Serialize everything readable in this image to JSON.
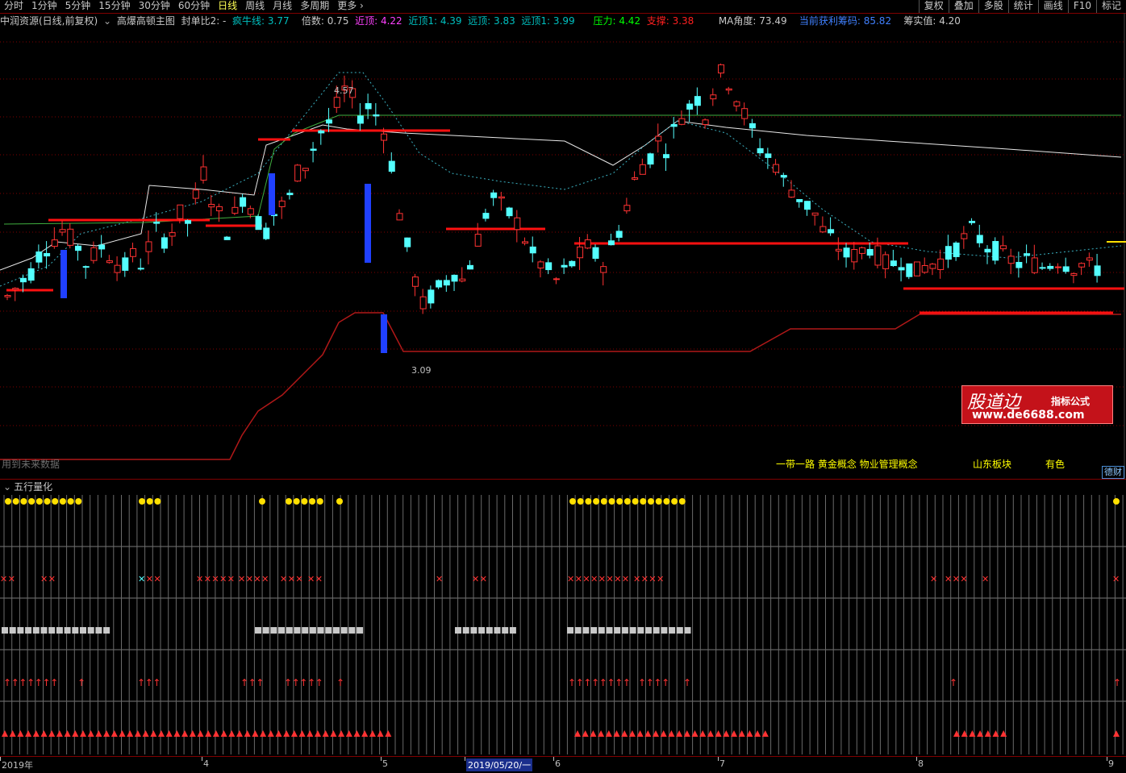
{
  "toolbar": {
    "tabs": [
      "分时",
      "1分钟",
      "5分钟",
      "15分钟",
      "30分钟",
      "60分钟",
      "日线",
      "周线",
      "月线",
      "多周期",
      "更多"
    ],
    "active_tab": "日线",
    "right_tools": [
      "复权",
      "叠加",
      "多股",
      "统计",
      "画线",
      "F10",
      "标记"
    ]
  },
  "info": {
    "stock": "中润资源(日线,前复权)",
    "indicator": "高爆高顿主图",
    "fengdan": "封单比2: -",
    "fengniu_label": "疯牛线: ",
    "fengniu_value": "3.77",
    "beishu_label": "倍数: ",
    "beishu_value": "0.75",
    "jinding_label": "近顶: ",
    "jinding_value": "4.22",
    "jinding1_label": "近顶1: ",
    "jinding1_value": "4.39",
    "yuanding_label": "远顶: ",
    "yuanding_value": "3.83",
    "yuanding1_label": "远顶1: ",
    "yuanding1_value": "3.99",
    "yali_label": "压力: ",
    "yali_value": "4.42",
    "zhicheng_label": "支撑: ",
    "zhicheng_value": "3.38",
    "ma_label": "MA角度: ",
    "ma_value": "73.49",
    "profit_label": "当前获利筹码: ",
    "profit_value": "85.82",
    "chip_label": "筹实值: ",
    "chip_value": "4.20"
  },
  "price_labels": {
    "high": "4.57",
    "low": "3.09"
  },
  "left_tag": "用到未来数据",
  "concepts": [
    "一带一路 黄金概念 物业管理概念",
    "山东板块",
    "有色"
  ],
  "right_button": "德财",
  "lower_panel_title": "五行量化",
  "watermark": {
    "title": "股道边",
    "sub": "指标公式",
    "url": "www.de6688.com"
  },
  "date_axis": {
    "labels": [
      "2019年",
      "4",
      "5",
      "2019/05/20/一",
      "6",
      "7",
      "8",
      "9"
    ]
  },
  "colors": {
    "up": "#ff3232",
    "down": "#54ffff",
    "blue": "#2040ff",
    "yellow": "#ffe000",
    "grid": "#800000"
  }
}
